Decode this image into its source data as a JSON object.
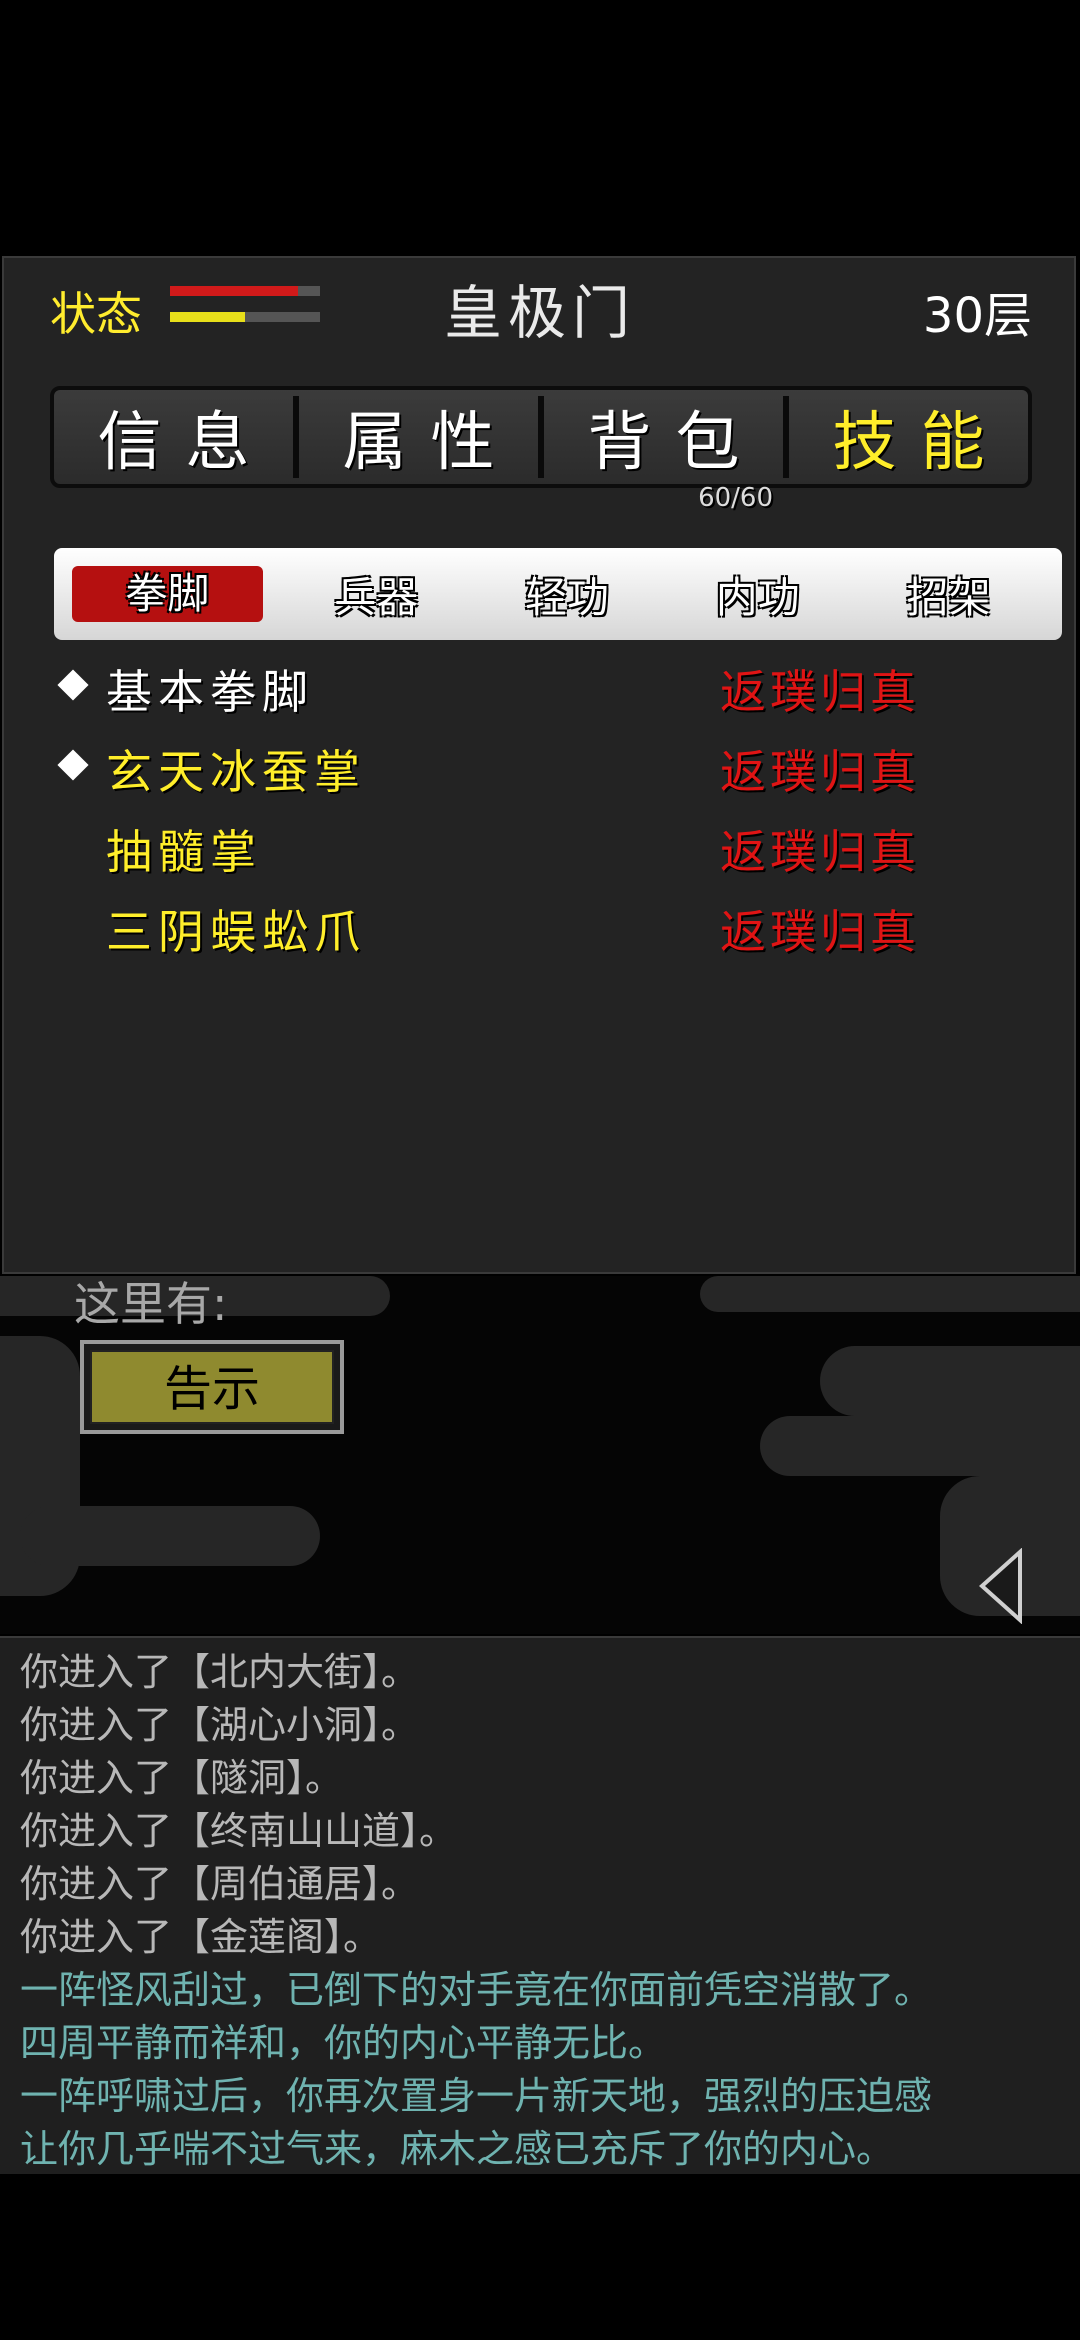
{
  "header": {
    "status_label": "状态",
    "hp_fraction": 0.85,
    "mp_fraction": 0.5,
    "sect_name": "皇极门",
    "floor": "30层"
  },
  "main_tabs": [
    {
      "label": "信息"
    },
    {
      "label": "属性"
    },
    {
      "label": "背包",
      "badge": "60/60"
    },
    {
      "label": "技能",
      "active": true
    }
  ],
  "sub_tabs": [
    {
      "label": "拳脚",
      "active": true
    },
    {
      "label": "兵器"
    },
    {
      "label": "轻功"
    },
    {
      "label": "内功"
    },
    {
      "label": "招架"
    }
  ],
  "skills": [
    {
      "name": "基本拳脚",
      "level": "返璞归真"
    },
    {
      "name": "玄天冰蚕掌",
      "level": "返璞归真"
    },
    {
      "name": "抽髓掌",
      "level": "返璞归真"
    },
    {
      "name": "三阴蜈蚣爪",
      "level": "返璞归真"
    }
  ],
  "scene": {
    "here_label": "这里有:",
    "notice_button": "告示"
  },
  "log": [
    "你进入了【北内大街】。",
    "你进入了【湖心小洞】。",
    "你进入了【隧洞】。",
    "你进入了【终南山山道】。",
    "你进入了【周伯通居】。",
    "你进入了【金莲阁】。",
    "一阵怪风刮过，已倒下的对手竟在你面前凭空消散了。",
    "四周平静而祥和，你的内心平静无比。",
    "一阵呼啸过后，你再次置身一片新天地，强烈的压迫感",
    "让你几乎喘不过气来，麻木之感已充斥了你的内心。"
  ]
}
